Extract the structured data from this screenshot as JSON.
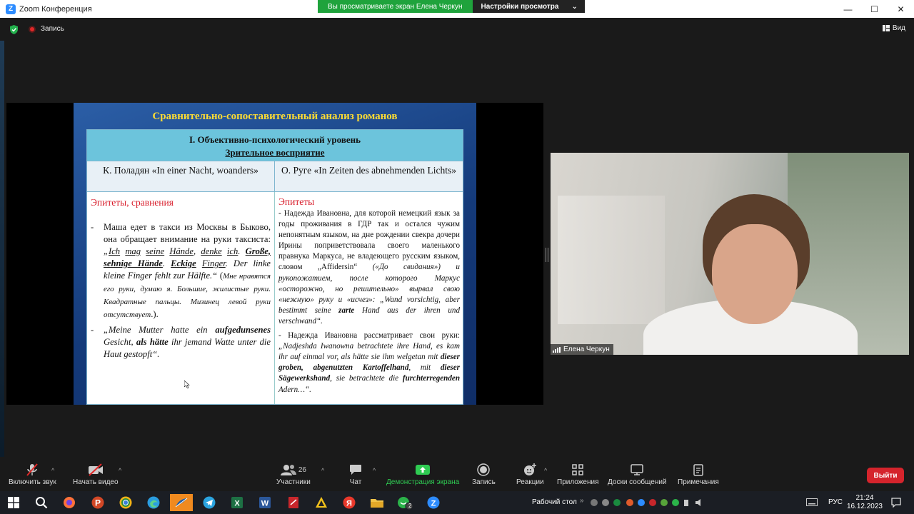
{
  "window": {
    "title": "Zoom Конференция",
    "min": "—",
    "max": "☐",
    "close": "✕"
  },
  "share_banner": {
    "status": "Вы просматриваете экран Елена Черкун",
    "settings": "Настройки просмотра"
  },
  "infobar": {
    "record_label": "Запись",
    "view_label": "Вид"
  },
  "slide": {
    "title": "Сравнительно-сопоставительный анализ романов",
    "level": "I. Объективно-психологический уровень",
    "sublevel": "Зрительное восприятие",
    "left_col": {
      "header": "К. Поладян «In einer Nacht, woanders»",
      "section": "Эпитеты, сравнения"
    },
    "right_col": {
      "header": "О. Руге «In Zeiten des abnehmenden Lichts»",
      "section": "Эпитеты"
    }
  },
  "video": {
    "name": "Елена Черкун"
  },
  "toolbar": {
    "audio": "Включить звук",
    "video": "Начать видео",
    "participants": "Участники",
    "participants_count": "26",
    "chat": "Чат",
    "share": "Демонстрация экрана",
    "record": "Запись",
    "reactions": "Реакции",
    "apps": "Приложения",
    "whiteboards": "Доски сообщений",
    "notes": "Примечания",
    "leave": "Выйти"
  },
  "taskbar": {
    "desktop": "Рабочий стол",
    "lang": "РУС",
    "time": "21:24",
    "date": "16.12.2023",
    "whatsapp_badge": "2"
  }
}
